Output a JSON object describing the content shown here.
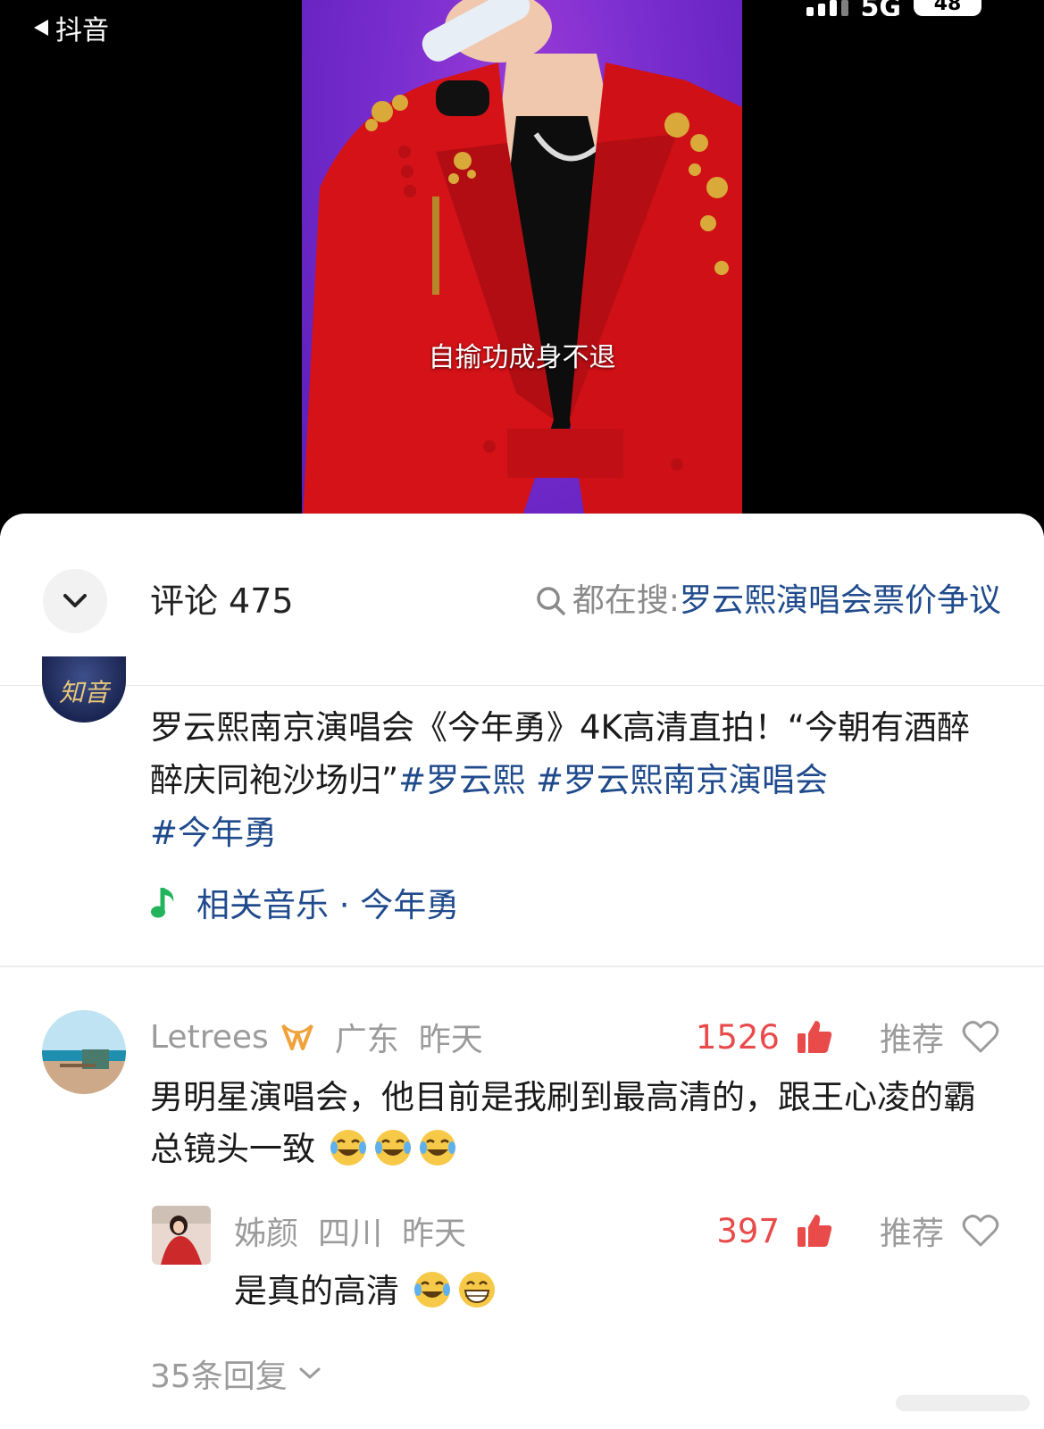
{
  "status_bar": {
    "back_label": "抖音",
    "network": "5G",
    "battery": "48"
  },
  "video": {
    "subtitle": "自揄功成身不退"
  },
  "comments_header": {
    "title": "评论",
    "count": "475",
    "search_prefix": "都在搜:",
    "search_topic": "罗云熙演唱会票价争议"
  },
  "pinned_post": {
    "avatar_text": "知音",
    "text": "罗云熙南京演唱会《今年勇》4K高清直拍！“今朝有酒醉 醉庆同袍沙场归”",
    "tags": [
      "#罗云熙",
      "#罗云熙南京演唱会",
      "#今年勇"
    ],
    "music_label": "相关音乐 · 今年勇"
  },
  "comments": [
    {
      "user": "Letrees",
      "location": "广东",
      "time": "昨天",
      "likes": "1526",
      "recommend_label": "推荐",
      "text": "男明星演唱会，他目前是我刷到最高清的，跟王心凌的霸总镜头一致",
      "emojis": [
        "laugh-cry",
        "laugh-cry",
        "laugh-cry"
      ]
    },
    {
      "user": "姊颜",
      "location": "四川",
      "time": "昨天",
      "likes": "397",
      "recommend_label": "推荐",
      "text": "是真的高清",
      "emojis": [
        "laugh-cry",
        "grin"
      ]
    }
  ],
  "replies": {
    "label": "35条回复"
  },
  "colors": {
    "link_blue": "#1f4a8c",
    "like_red": "#e94b4b",
    "music_green": "#22b35b",
    "muted_gray": "#9b9b9b"
  },
  "icons": [
    "back-arrow-icon",
    "chevron-down-icon",
    "search-icon",
    "music-note-icon",
    "thumbs-up-icon",
    "heart-outline-icon",
    "laugh-cry-emoji-icon",
    "grin-emoji-icon",
    "user-badge-icon"
  ]
}
